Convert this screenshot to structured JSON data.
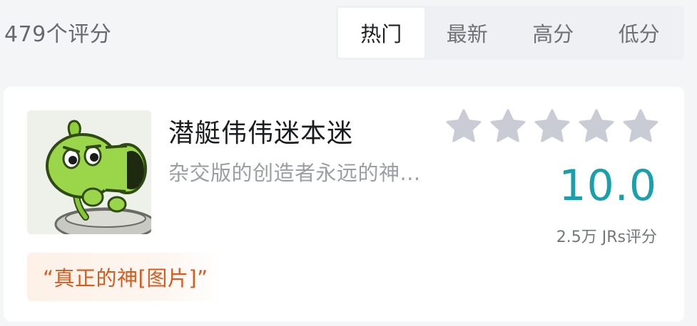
{
  "header": {
    "count_label": "479个评分",
    "tabs": [
      {
        "label": "热门",
        "active": true
      },
      {
        "label": "最新",
        "active": false
      },
      {
        "label": "高分",
        "active": false
      },
      {
        "label": "低分",
        "active": false
      }
    ]
  },
  "card": {
    "avatar_icon": "peashooter-plant-icon",
    "title": "潜艇伟伟迷本迷",
    "subtitle": "杂交版的创造者永远的神...",
    "rating": {
      "stars_total": 5,
      "stars_filled": 0,
      "score": "10.0",
      "raters": "2.5万 JRs评分"
    },
    "quote": "“真正的神[图片]”"
  },
  "colors": {
    "accent_score": "#1aa0ac",
    "quote_text": "#d65b1f",
    "star_empty": "#c9ccd4"
  }
}
